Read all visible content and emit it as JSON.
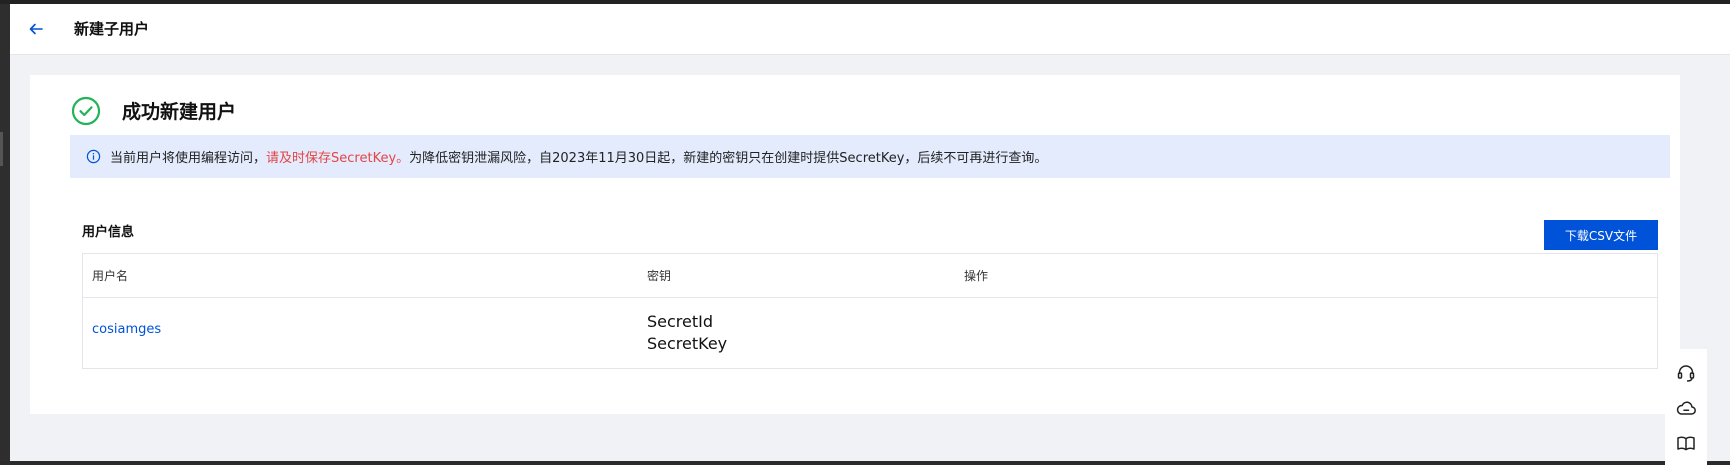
{
  "header": {
    "back_icon": "arrow-left-icon",
    "title": "新建子用户"
  },
  "result": {
    "icon": "check-circle-icon",
    "title": "成功新建用户",
    "success_color": "#23b359"
  },
  "notice": {
    "icon": "info-circle-icon",
    "text_before": "当前用户将使用编程访问，",
    "text_warning": "请及时保存SecretKey。",
    "text_after": "为降低密钥泄漏风险，自2023年11月30日起，新建的密钥只在创建时提供SecretKey，后续不可再进行查询。",
    "warning_color": "#e54545"
  },
  "user_info": {
    "section_title": "用户信息",
    "download_button": "下载CSV文件",
    "columns": [
      "用户名",
      "密钥",
      "操作"
    ],
    "rows": [
      {
        "username": "cosiamges",
        "secret_id_label": "SecretId",
        "secret_key_label": "SecretKey",
        "actions": ""
      }
    ]
  },
  "float_toolbar": {
    "items": [
      "headset-icon",
      "cloud-icon",
      "book-icon"
    ]
  },
  "colors": {
    "brand": "#0052d9",
    "page_bg": "#f1f2f6",
    "notice_bg": "#e3ebfd"
  }
}
